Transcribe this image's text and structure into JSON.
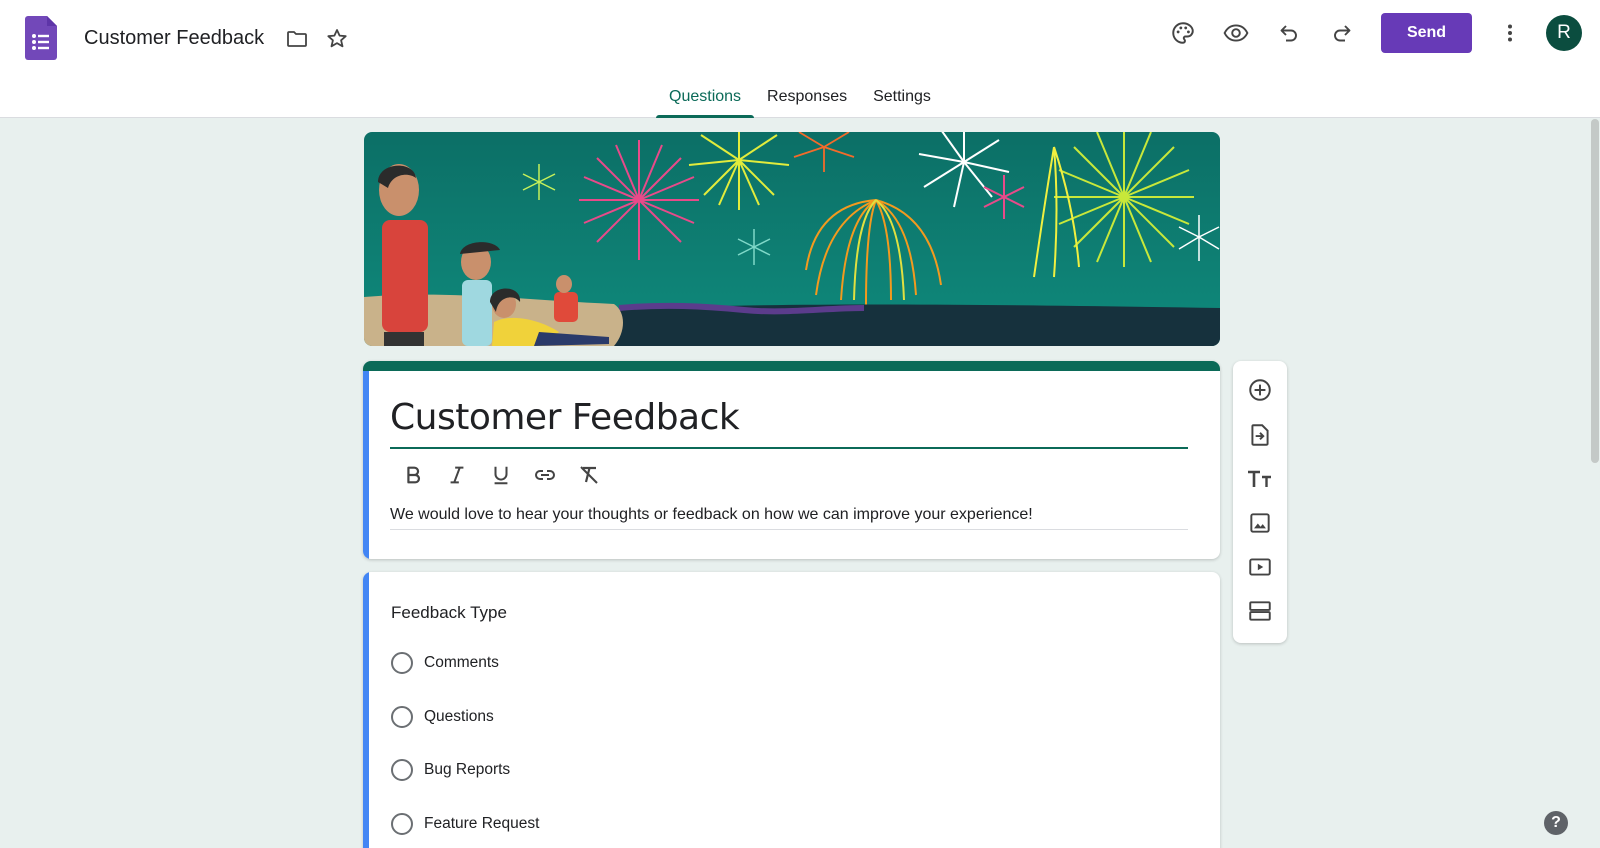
{
  "header": {
    "doc_title": "Customer Feedback",
    "send_label": "Send",
    "avatar_initial": "R",
    "icons": [
      "forms-logo-icon",
      "folder-icon",
      "star-icon",
      "palette-icon",
      "preview-eye-icon",
      "undo-icon",
      "redo-icon",
      "more-vert-icon"
    ]
  },
  "tabs": [
    {
      "label": "Questions",
      "active": true
    },
    {
      "label": "Responses",
      "active": false
    },
    {
      "label": "Settings",
      "active": false
    }
  ],
  "form": {
    "title": "Customer Feedback",
    "description": "We would love to hear your thoughts or feedback on how we can improve your experience!",
    "format_tools": [
      "bold-icon",
      "italic-icon",
      "underline-icon",
      "link-icon",
      "clear-format-icon"
    ]
  },
  "question": {
    "title": "Feedback Type",
    "options": [
      "Comments",
      "Questions",
      "Bug Reports",
      "Feature Request"
    ]
  },
  "side_toolbar": [
    "add-question-icon",
    "import-questions-icon",
    "add-title-icon",
    "add-image-icon",
    "add-video-icon",
    "add-section-icon"
  ],
  "colors": {
    "accent": "#673ab7",
    "theme": "#0b6a58",
    "background": "#e8f0ee",
    "card_highlight": "#4285f4"
  },
  "help_label": "?"
}
